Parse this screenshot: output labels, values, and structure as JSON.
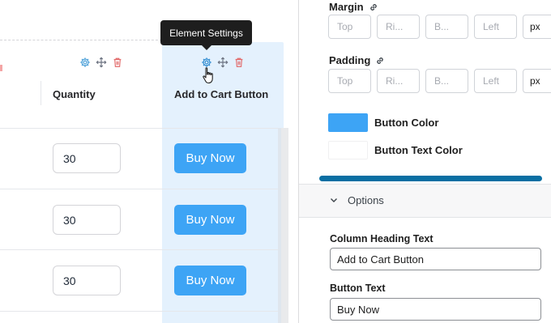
{
  "table": {
    "headers": {
      "quantity": "Quantity",
      "add_to_cart": "Add to Cart Button"
    },
    "rows": [
      {
        "quantity": "30",
        "button": "Buy Now"
      },
      {
        "quantity": "30",
        "button": "Buy Now"
      },
      {
        "quantity": "30",
        "button": "Buy Now"
      }
    ]
  },
  "tooltip": "Element Settings",
  "icons": {
    "column_settings": "gear-icon",
    "column_move": "move-arrows-icon",
    "column_delete": "trash-icon",
    "link_values": "link-icon",
    "options_toggle": "chevron-down-icon",
    "pointer": "hand-pointer-icon"
  },
  "settings": {
    "margin": {
      "label": "Margin",
      "placeholders": {
        "top": "Top",
        "right": "Ri...",
        "bottom": "B...",
        "left": "Left"
      },
      "unit": "px"
    },
    "padding": {
      "label": "Padding",
      "placeholders": {
        "top": "Top",
        "right": "Ri...",
        "bottom": "B...",
        "left": "Left"
      },
      "unit": "px"
    },
    "button_color": {
      "label": "Button Color",
      "value": "#3da4f5"
    },
    "button_text_color": {
      "label": "Button Text Color",
      "value": "#ffffff"
    },
    "options": {
      "label": "Options",
      "column_heading_label": "Column Heading Text",
      "column_heading_value": "Add to Cart Button",
      "button_text_label": "Button Text",
      "button_text_value": "Buy Now"
    }
  },
  "colors": {
    "accent": "#3da4f5",
    "column_highlight": "#e4f1fd",
    "delete_icon": "#e26a6a",
    "settings_icon": "#4a9fd8",
    "progress": "#096fa3"
  }
}
